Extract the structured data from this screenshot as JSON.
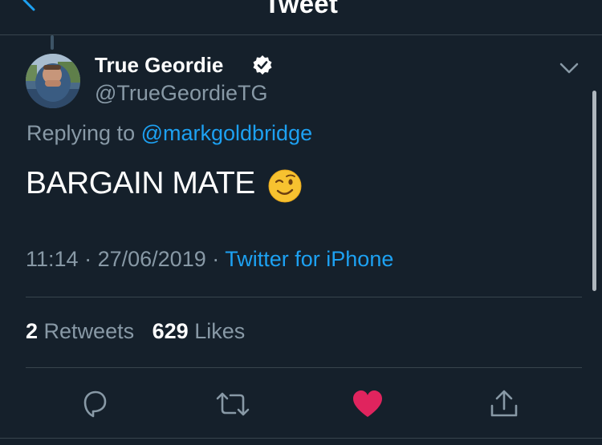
{
  "nav": {
    "title": "Tweet"
  },
  "tweet": {
    "display_name": "True Geordie",
    "handle": "@TrueGeordieTG",
    "verified": true,
    "replying_prefix": "Replying to ",
    "replying_to": "@markgoldbridge",
    "text": "BARGAIN MATE",
    "emoji": "winking-face-emoji",
    "time": "11:14",
    "date": "27/06/2019",
    "separator": "·",
    "source": "Twitter for iPhone"
  },
  "stats": {
    "retweets_count": "2",
    "retweets_label": "Retweets",
    "likes_count": "629",
    "likes_label": "Likes"
  },
  "actions": {
    "reply_icon": "reply-icon",
    "retweet_icon": "retweet-icon",
    "like_icon": "heart-icon",
    "like_active": true,
    "share_icon": "share-icon"
  },
  "colors": {
    "background": "#15202b",
    "accent": "#1da1f2",
    "secondary_text": "#8899a6",
    "like": "#e0245e",
    "divider": "#38444d"
  }
}
